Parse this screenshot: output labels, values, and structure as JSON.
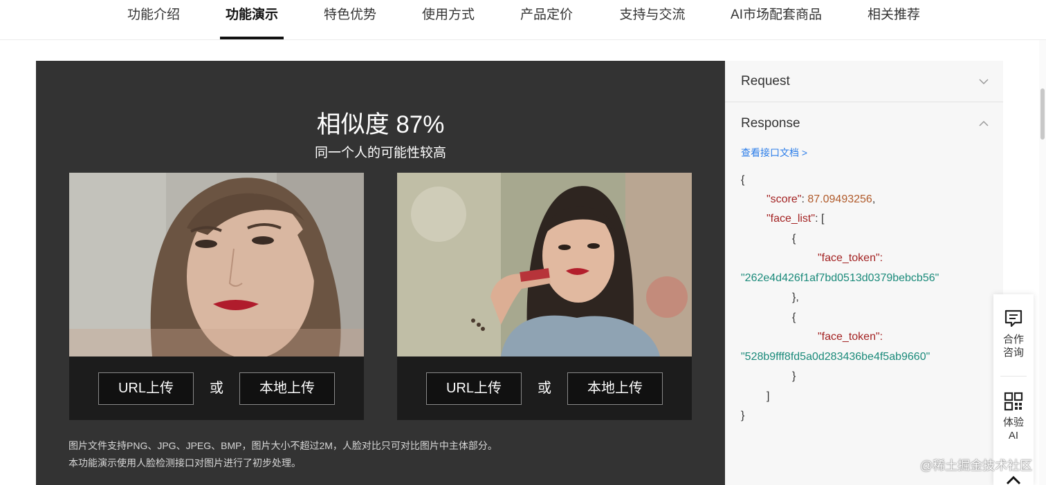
{
  "nav": {
    "tabs": [
      {
        "label": "功能介绍"
      },
      {
        "label": "功能演示",
        "active": true
      },
      {
        "label": "特色优势"
      },
      {
        "label": "使用方式"
      },
      {
        "label": "产品定价"
      },
      {
        "label": "支持与交流"
      },
      {
        "label": "AI市场配套商品"
      },
      {
        "label": "相关推荐"
      }
    ]
  },
  "demo": {
    "score_title": "相似度 87%",
    "score_subtitle": "同一个人的可能性较高",
    "cards": [
      {
        "url_button": "URL上传",
        "or_label": "或",
        "local_button": "本地上传"
      },
      {
        "url_button": "URL上传",
        "or_label": "或",
        "local_button": "本地上传"
      }
    ],
    "notes": [
      "图片文件支持PNG、JPG、JPEG、BMP，图片大小不超过2M，人脸对比只可对比图片中主体部分。",
      "本功能演示使用人脸检测接口对图片进行了初步处理。"
    ]
  },
  "panel": {
    "request_label": "Request",
    "response_label": "Response",
    "doc_link": "查看接口文档 >",
    "json_lines": {
      "open_brace": "{",
      "score_key": "\"score\"",
      "score_sep": ": ",
      "score_value": "87.09493256",
      "score_comma": ",",
      "face_list_key": "\"face_list\"",
      "face_list_open": ": [",
      "obj1_open": "{",
      "token1_key": "\"face_token\":",
      "token1_value": "\"262e4d426f1af7bd0513d0379bebcb56\"",
      "obj1_close": "},",
      "obj2_open": "{",
      "token2_key": "\"face_token\":",
      "token2_value": "\"528b9fff8fd5a0d283436be4f5ab9660\"",
      "obj2_close": "}",
      "list_close": "]",
      "close_brace": "}"
    }
  },
  "float_bar": {
    "consult_line1": "合作",
    "consult_line2": "咨询",
    "trial_line1": "体验",
    "trial_line2": "AI"
  },
  "watermark": "@稀土掘金技术社区"
}
